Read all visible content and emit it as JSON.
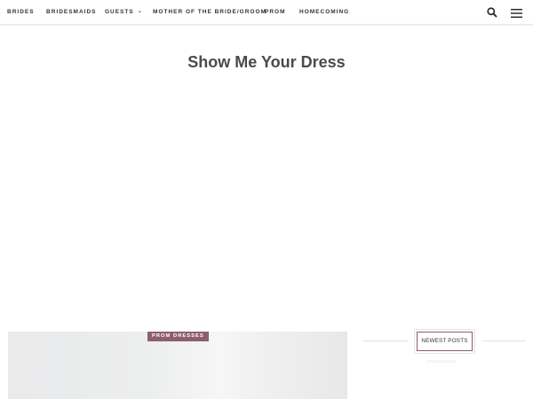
{
  "nav": {
    "items": [
      {
        "label": "BRIDES"
      },
      {
        "label": "BRIDESMAIDS"
      },
      {
        "label": "GUESTS",
        "chevron": "⌄"
      },
      {
        "label": "MOTHER OF THE BRIDE/GROOM"
      },
      {
        "label": "PROM"
      },
      {
        "label": "HOMECOMING"
      }
    ],
    "search_icon": "search-icon",
    "menu_icon": "hamburger-menu-icon"
  },
  "site": {
    "title": "Show Me Your Dress"
  },
  "featured_post": {
    "category": "PROM DRESSES"
  },
  "sidebar": {
    "widget_title": "NEWEST POSTS"
  },
  "colors": {
    "accent": "#8c5f6c",
    "text": "#333333",
    "divider": "#e2e2e2"
  }
}
